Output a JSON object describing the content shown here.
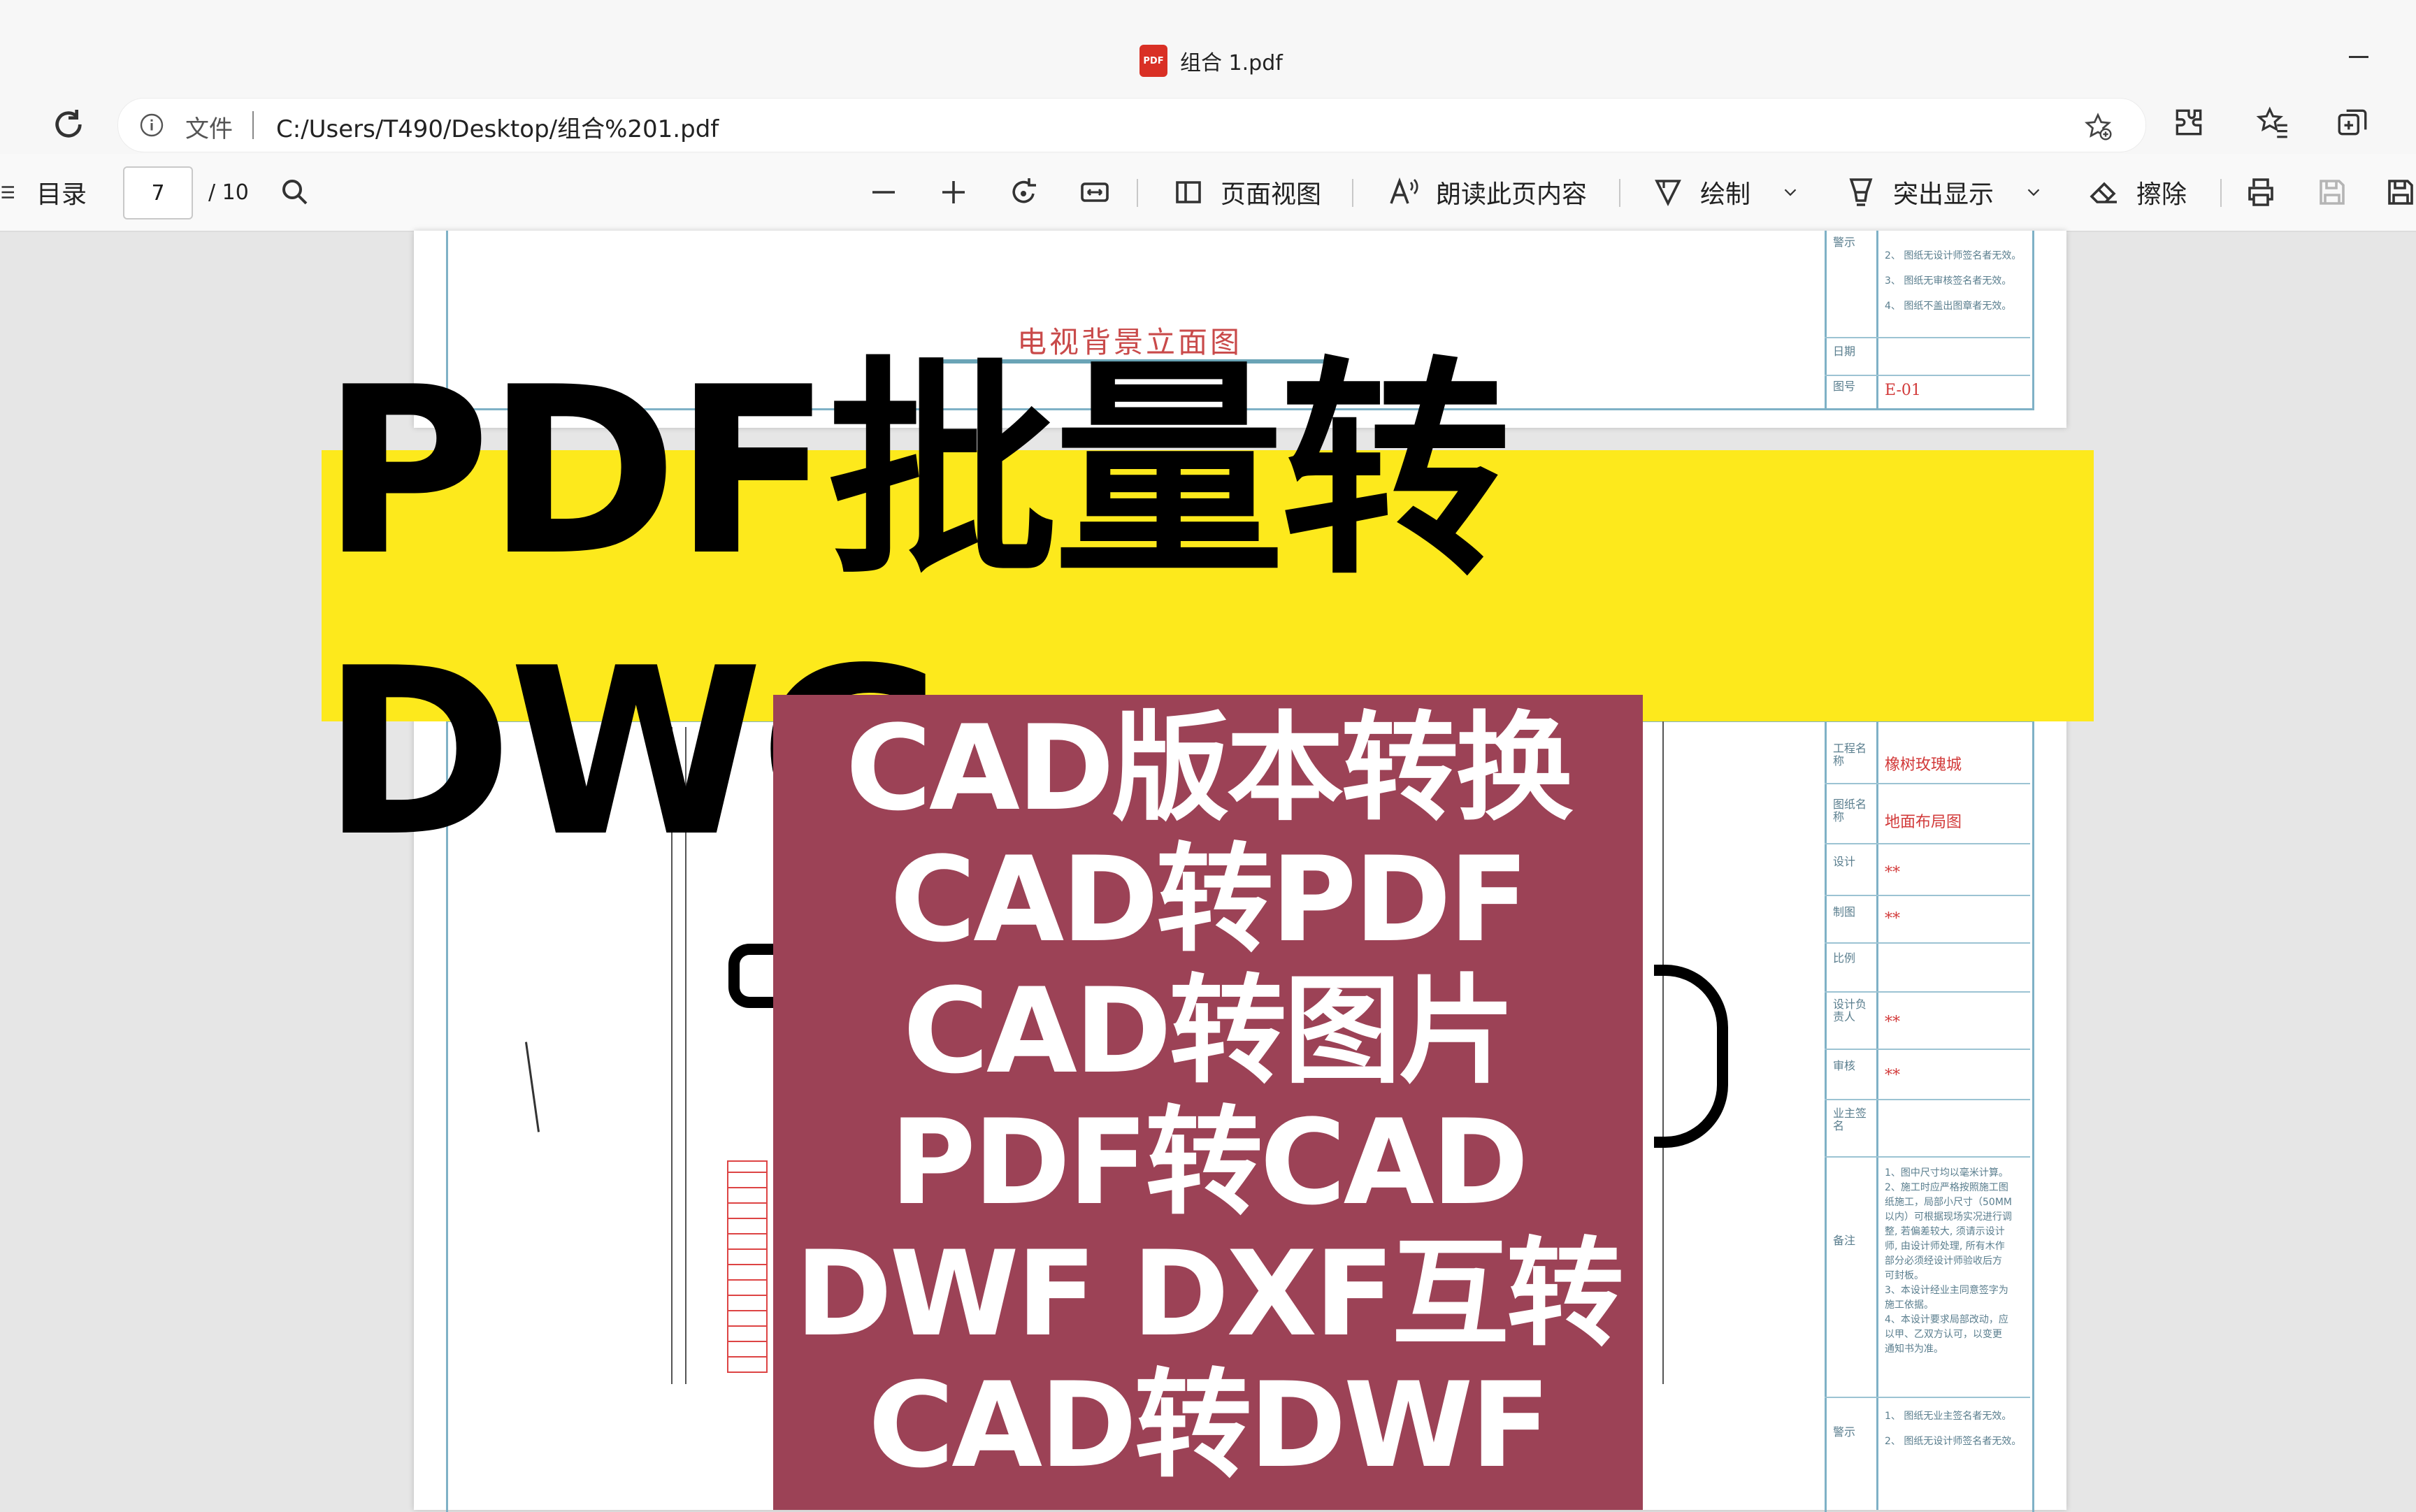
{
  "browser": {
    "tab_title": "组合 1.pdf",
    "file_label": "文件",
    "url": "C:/Users/T490/Desktop/组合%201.pdf"
  },
  "pdf_toolbar": {
    "toc_label": "目录",
    "current_page": "7",
    "total_pages": "/ 10",
    "page_view_label": "页面视图",
    "read_aloud_label": "朗读此页内容",
    "draw_label": "绘制",
    "highlight_label": "突出显示",
    "erase_label": "擦除"
  },
  "document": {
    "page1": {
      "title": "电视背景立面图",
      "warning_label": "警示",
      "warning_notes": [
        "2、 图纸无设计师签名者无效。",
        "3、 图纸无审核签名者无效。",
        "4、 图纸不盖出图章者无效。"
      ],
      "date_label": "日期",
      "drawing_no_label": "图号",
      "drawing_no": "E-01"
    },
    "page2": {
      "project_label": "工程名称",
      "project_value": "橡树玫瑰城",
      "sheet_label": "图纸名称",
      "sheet_value": "地面布局图",
      "design_label": "设计",
      "design_value": "**",
      "drawn_label": "制图",
      "drawn_value": "**",
      "scale_label": "比例",
      "lead_label": "设计负责人",
      "lead_value": "**",
      "review_label": "审核",
      "review_value": "**",
      "owner_label": "业主签名",
      "remarks_label": "备注",
      "remarks": [
        "1、图中尺寸均以毫米计算。",
        "2、施工时应严格按照施工图",
        "纸施工，局部小尺寸（50MM",
        "以内）可根据现场实况进行调",
        "整, 若偏差较大, 须请示设计",
        "师, 由设计师处理, 所有木作",
        "部分必须经设计师验收后方",
        "可封板。",
        "3、本设计经业主同意签字为",
        "施工依据。",
        "4、本设计要求局部改动，应",
        "以甲、乙双方认可，以变更",
        "通知书为准。"
      ],
      "warning_label": "警示",
      "warning_notes": [
        "1、 图纸无业主签名者无效。",
        "2、 图纸无设计师签名者无效。"
      ]
    }
  },
  "overlay": {
    "headline": "PDF批量转DWG",
    "features": [
      "CAD版本转换",
      "CAD转PDF",
      "CAD转图片",
      "PDF转CAD",
      "DWF DXF互转",
      "CAD转DWF"
    ]
  },
  "colors": {
    "banner": "#fde91c",
    "panel": "#9c4256",
    "drawing_red": "#c94a4a",
    "frame_blue": "#7fb1c6"
  }
}
